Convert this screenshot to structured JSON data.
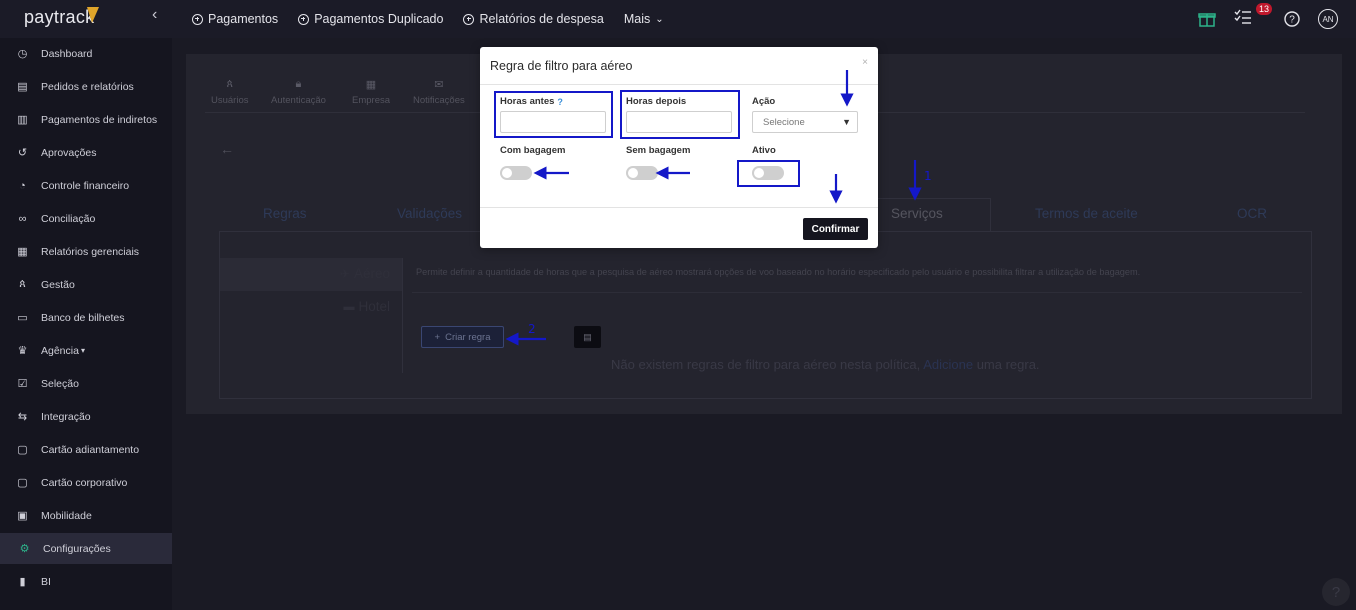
{
  "topbar": {
    "logo": "paytrack",
    "nav": [
      "Pagamentos",
      "Pagamentos Duplicado",
      "Relatórios de despesa"
    ],
    "more": "Mais",
    "badge_count": "13",
    "avatar": "AN"
  },
  "sidebar": {
    "items": [
      {
        "label": "Dashboard",
        "icon": "dashboard-icon"
      },
      {
        "label": "Pedidos e relatórios",
        "icon": "document-icon"
      },
      {
        "label": "Pagamentos de indiretos",
        "icon": "barcode-icon"
      },
      {
        "label": "Aprovações",
        "icon": "history-icon"
      },
      {
        "label": "Controle financeiro",
        "icon": "chart-pie-icon"
      },
      {
        "label": "Conciliação",
        "icon": "link-icon"
      },
      {
        "label": "Relatórios gerenciais",
        "icon": "report-icon"
      },
      {
        "label": "Gestão",
        "icon": "users-icon"
      },
      {
        "label": "Banco de bilhetes",
        "icon": "ticket-icon"
      },
      {
        "label": "Agência",
        "icon": "crown-icon"
      },
      {
        "label": "Seleção",
        "icon": "checkbox-icon"
      },
      {
        "label": "Integração",
        "icon": "sync-icon"
      },
      {
        "label": "Cartão adiantamento",
        "icon": "card-icon"
      },
      {
        "label": "Cartão corporativo",
        "icon": "card-icon"
      },
      {
        "label": "Mobilidade",
        "icon": "car-icon"
      },
      {
        "label": "Configurações",
        "icon": "gear-icon"
      },
      {
        "label": "BI",
        "icon": "bar-chart-icon"
      }
    ]
  },
  "settings_tabs": [
    "Usuários",
    "Autenticação",
    "Empresa",
    "Notificações"
  ],
  "main_tabs": [
    "Regras",
    "Validações",
    "Serviços",
    "Termos de aceite",
    "OCR"
  ],
  "service_nav": [
    "Aéreo",
    "Hotel"
  ],
  "description": "Permite definir a quantidade de horas que a pesquisa de aéreo mostrará opções de voo baseado no horário especificado pelo usuário e possibilita filtrar a utilização de bagagem.",
  "create_rule_label": "Criar regra",
  "empty": {
    "before": "Não existem regras de filtro para aéreo nesta política,",
    "link": "Adicione",
    "after": "uma regra."
  },
  "modal": {
    "title": "Regra de filtro para aéreo",
    "close": "×",
    "horas_antes": "Horas antes",
    "horas_antes_help": "?",
    "horas_depois": "Horas depois",
    "acao": "Ação",
    "acao_placeholder": "Selecione",
    "com_bagagem": "Com bagagem",
    "sem_bagagem": "Sem bagagem",
    "ativo": "Ativo",
    "confirm": "Confirmar"
  },
  "annotations": [
    "1",
    "2"
  ],
  "colors": {
    "annotation": "#1418c8",
    "dark": "#15151f"
  }
}
